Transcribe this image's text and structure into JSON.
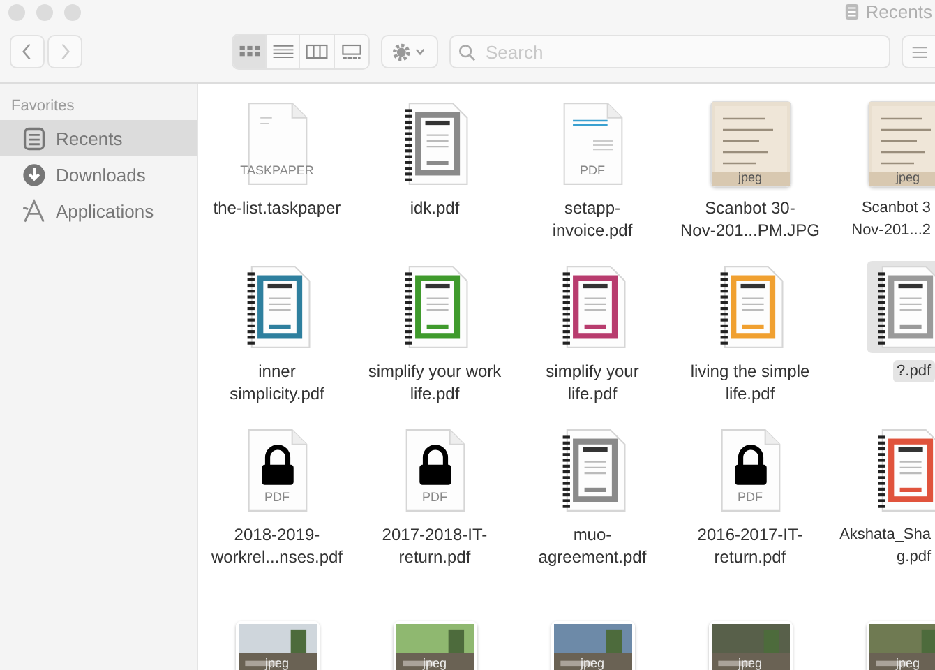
{
  "window": {
    "title": "Recents"
  },
  "toolbar": {
    "views": [
      {
        "kind": "icons",
        "selected": true
      },
      {
        "kind": "list",
        "selected": false
      },
      {
        "kind": "columns",
        "selected": false
      },
      {
        "kind": "gallery",
        "selected": false
      }
    ],
    "search": {
      "placeholder": "Search"
    }
  },
  "sidebar": {
    "heading": "Favorites",
    "items": [
      {
        "kind": "recents",
        "label": "Recents",
        "selected": true
      },
      {
        "kind": "downloads",
        "label": "Downloads",
        "selected": false
      },
      {
        "kind": "applications",
        "label": "Applications",
        "selected": false
      }
    ]
  },
  "files": [
    {
      "kind": "taskpaper",
      "badge": "TASKPAPER",
      "lines": [
        "the-list.taskpaper"
      ],
      "selected": false
    },
    {
      "kind": "binder",
      "color": "#8a8a8a",
      "lines": [
        "idk.pdf"
      ],
      "selected": false
    },
    {
      "kind": "pdf",
      "badge": "PDF",
      "lines": [
        "setapp-",
        "invoice.pdf"
      ],
      "selected": false
    },
    {
      "kind": "scan",
      "badge": "jpeg",
      "lines": [
        "Scanbot 30-",
        "Nov-201...PM.JPG"
      ],
      "selected": false
    },
    {
      "kind": "scan",
      "badge": "jpeg",
      "lines": [
        "Scanbot 3",
        "Nov-201...2"
      ],
      "selected": false
    },
    {
      "kind": "binder",
      "color": "#2e7f9e",
      "lines": [
        "inner",
        "simplicity.pdf"
      ],
      "selected": false
    },
    {
      "kind": "binder",
      "color": "#3f9a2c",
      "lines": [
        "simplify your work",
        "life.pdf"
      ],
      "selected": false
    },
    {
      "kind": "binder",
      "color": "#b83c6e",
      "lines": [
        "simplify your",
        "life.pdf"
      ],
      "selected": false
    },
    {
      "kind": "binder",
      "color": "#f0a030",
      "lines": [
        "living the simple",
        "life.pdf"
      ],
      "selected": false
    },
    {
      "kind": "binder",
      "color": "#9a9a9a",
      "lines": [
        "?.pdf"
      ],
      "selected": true
    },
    {
      "kind": "locked",
      "badge": "PDF",
      "lines": [
        "2018-2019-",
        "workrel...nses.pdf"
      ],
      "selected": false
    },
    {
      "kind": "locked",
      "badge": "PDF",
      "lines": [
        "2017-2018-IT-",
        "return.pdf"
      ],
      "selected": false
    },
    {
      "kind": "binder",
      "color": "#8a8a8a",
      "lines": [
        "muo-",
        "agreement.pdf"
      ],
      "selected": false
    },
    {
      "kind": "locked",
      "badge": "PDF",
      "lines": [
        "2016-2017-IT-",
        "return.pdf"
      ],
      "selected": false
    },
    {
      "kind": "binder",
      "color": "#e0533c",
      "lines": [
        "Akshata_Sha",
        "g.pdf"
      ],
      "selected": false
    },
    {
      "badge": "jpeg",
      "selected": false
    },
    {
      "badge": "jpeg",
      "selected": false
    },
    {
      "badge": "jpeg",
      "selected": false
    },
    {
      "badge": "jpeg",
      "selected": false
    },
    {
      "badge": "jpeg",
      "selected": false
    }
  ]
}
